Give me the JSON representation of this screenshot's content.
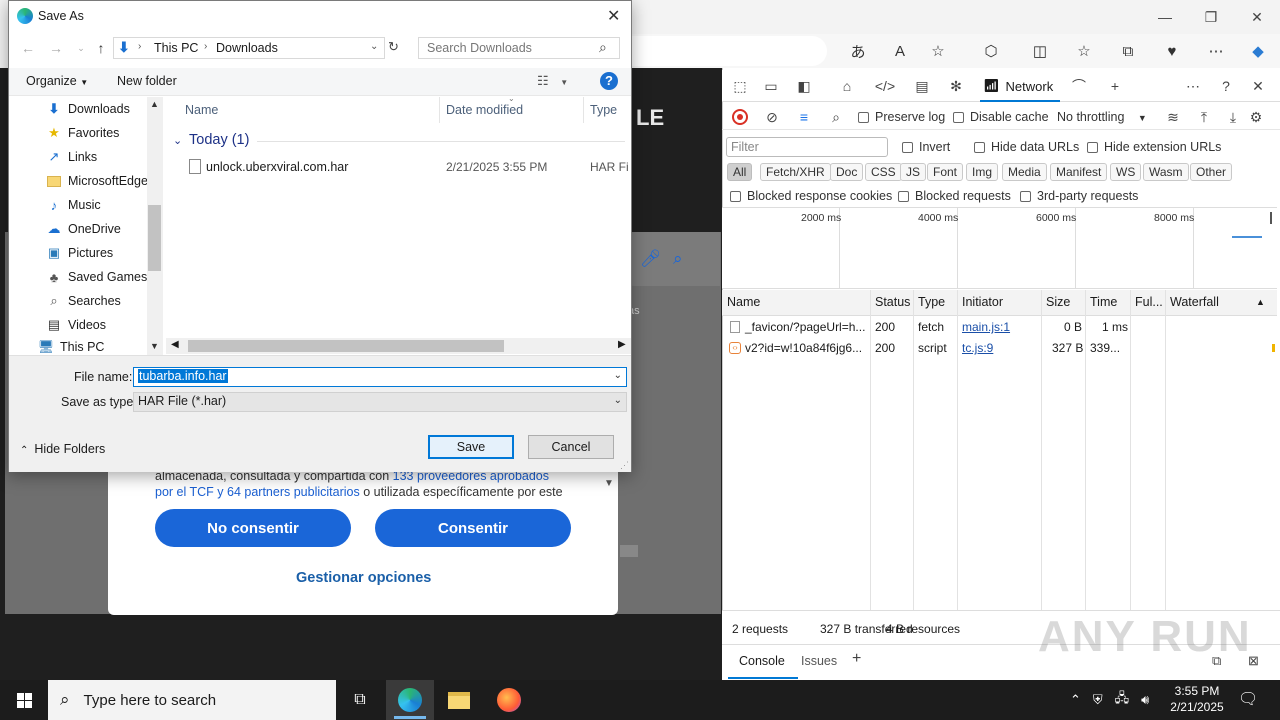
{
  "dialog": {
    "title": "Save As",
    "breadcrumb": [
      "This PC",
      "Downloads"
    ],
    "search_placeholder": "Search Downloads",
    "organize_label": "Organize",
    "new_folder_label": "New folder",
    "tree_items": [
      {
        "label": "Downloads",
        "icon": "download-icon"
      },
      {
        "label": "Favorites",
        "icon": "star-folder-icon"
      },
      {
        "label": "Links",
        "icon": "link-icon"
      },
      {
        "label": "MicrosoftEdge",
        "icon": "folder-icon"
      },
      {
        "label": "Music",
        "icon": "music-icon"
      },
      {
        "label": "OneDrive",
        "icon": "cloud-icon"
      },
      {
        "label": "Pictures",
        "icon": "pictures-icon"
      },
      {
        "label": "Saved Games",
        "icon": "games-icon"
      },
      {
        "label": "Searches",
        "icon": "search-icon"
      },
      {
        "label": "Videos",
        "icon": "videos-icon"
      },
      {
        "label": "This PC",
        "icon": "computer-icon"
      }
    ],
    "columns": {
      "name": "Name",
      "date": "Date modified",
      "type": "Type"
    },
    "group_label": "Today (1)",
    "files": [
      {
        "name": "unlock.uberxviral.com.har",
        "date": "2/21/2025 3:55 PM",
        "type": "HAR File"
      }
    ],
    "file_name_label": "File name:",
    "file_name_value": "tubarba.info.har",
    "save_type_label": "Save as type:",
    "save_type_value": "HAR File (*.har)",
    "hide_folders_label": "Hide Folders",
    "save_label": "Save",
    "cancel_label": "Cancel"
  },
  "page": {
    "logo_fragment": "LE",
    "consent_text_1": "almacenada, consultada y compartida con ",
    "consent_link_1": "133 proveedores aprobados",
    "consent_link_2": "por el TCF y 64 partners publicitarios",
    "consent_text_2": " o utilizada específicamente por este",
    "no_consent_label": "No consentir",
    "consent_label": "Consentir",
    "manage_label": "Gestionar opciones",
    "partial_text": "as"
  },
  "devtools": {
    "network_tab": "Network",
    "preserve_log": "Preserve log",
    "disable_cache": "Disable cache",
    "throttling": "No throttling",
    "filter_placeholder": "Filter",
    "invert": "Invert",
    "hide_data_urls": "Hide data URLs",
    "hide_extension_urls": "Hide extension URLs",
    "chips": [
      "All",
      "Fetch/XHR",
      "Doc",
      "CSS",
      "JS",
      "Font",
      "Img",
      "Media",
      "Manifest",
      "WS",
      "Wasm",
      "Other"
    ],
    "blocked_cookies": "Blocked response cookies",
    "blocked_requests": "Blocked requests",
    "third_party": "3rd-party requests",
    "timeline_labels": [
      "2000 ms",
      "4000 ms",
      "6000 ms",
      "8000 ms"
    ],
    "columns": [
      "Name",
      "Status",
      "Type",
      "Initiator",
      "Size",
      "Time",
      "Ful...",
      "Waterfall"
    ],
    "rows": [
      {
        "name": "_favicon/?pageUrl=h...",
        "status": "200",
        "type": "fetch",
        "initiator": "main.js:1",
        "size": "0 B",
        "time": "1 ms"
      },
      {
        "name": "v2?id=w!10a84f6jg6...",
        "status": "200",
        "type": "script",
        "initiator": "tc.js:9",
        "size": "327 B",
        "time": "339..."
      }
    ],
    "summary_requests": "2 requests",
    "summary_transferred": "327 B transferred",
    "summary_resources": "4 B resources",
    "drawer_console": "Console",
    "drawer_issues": "Issues"
  },
  "taskbar": {
    "search_placeholder": "Type here to search",
    "time": "3:55 PM",
    "date": "2/21/2025"
  },
  "watermark": "ANY RUN",
  "colors": {
    "accent": "#0078d7",
    "consent_blue": "#1a66d8",
    "record_red": "#d93025"
  }
}
